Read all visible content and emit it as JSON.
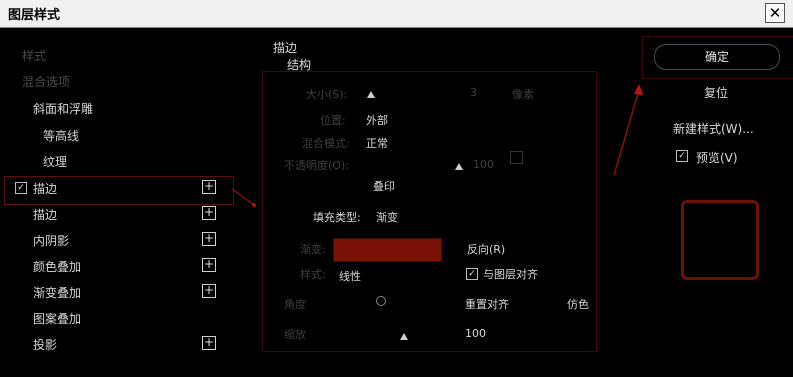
{
  "title": "图层样式",
  "close_glyph": "✕",
  "left": {
    "header1": "样式",
    "header2": "混合选项",
    "items": [
      {
        "label": "斜面和浮雕",
        "has_checkbox": false,
        "has_plus": false
      },
      {
        "label": "等高线",
        "has_checkbox": false,
        "has_plus": false
      },
      {
        "label": "纹理",
        "has_checkbox": false,
        "has_plus": false
      },
      {
        "label": "描边",
        "has_checkbox": true,
        "checked": true,
        "has_plus": true,
        "selected": true
      },
      {
        "label": "描边",
        "has_checkbox": false,
        "has_plus": true
      },
      {
        "label": "内阴影",
        "has_checkbox": false,
        "has_plus": true
      },
      {
        "label": "颜色叠加",
        "has_checkbox": false,
        "has_plus": true
      },
      {
        "label": "渐变叠加",
        "has_checkbox": false,
        "has_plus": true
      },
      {
        "label": "图案叠加",
        "has_checkbox": false,
        "has_plus": false
      },
      {
        "label": "投影",
        "has_checkbox": false,
        "has_plus": true
      }
    ],
    "plus_glyph": "+",
    "check_glyph": "✓"
  },
  "center": {
    "section_title": "描边",
    "section_sub": "结构",
    "size_label": "大小(S):",
    "size_value": "3",
    "size_unit": "像素",
    "position_label": "位置:",
    "position_value": "外部",
    "blend_label": "混合模式:",
    "blend_value": "正常",
    "opacity_label": "不透明度(O):",
    "opacity_value": "100",
    "overprint_label": "叠印",
    "fill_type_label": "填充类型:",
    "fill_type_value": "渐变",
    "gradient_label": "渐变:",
    "reverse_label": "反向(R)",
    "style_label": "样式:",
    "style_value": "线性",
    "align_layer_label": "与图层对齐",
    "angle_label": "角度",
    "reset_align_label": "重置对齐",
    "dither_label": "仿色",
    "scale_label": "缩放",
    "scale_value": "100"
  },
  "right": {
    "ok_label": "确定",
    "reset_label": "复位",
    "new_style_label": "新建样式(W)...",
    "preview_label": "预览(V)",
    "preview_checked": true,
    "check_glyph": "✓"
  },
  "colors": {
    "gradient": "#7a1208",
    "accent_red": "#b01010"
  }
}
